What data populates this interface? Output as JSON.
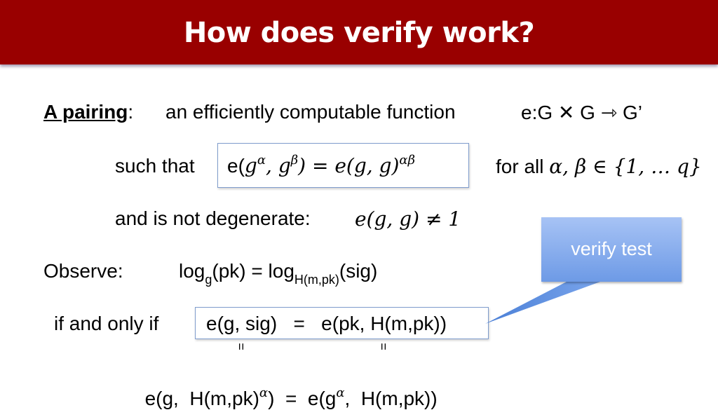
{
  "title": "How does verify work?",
  "pairing": {
    "label": "A pairing",
    "colon": ":",
    "description": "an efficiently computable function",
    "signature": "e:G ✕ G ⇾ G’"
  },
  "bilinear": {
    "prefix": "such that",
    "lhs_e": "e(",
    "lhs_g1": "g",
    "lhs_exp1": "α",
    "comma": ", ",
    "lhs_g2": "g",
    "lhs_exp2": "β",
    "rhs": ") = e(g, g)",
    "rhs_exp": "αβ",
    "forall": "for all",
    "domain": "α, β ∈ {1, … q}"
  },
  "nondegenerate": {
    "prefix": "and is not degenerate:",
    "expr": "e(g, g) ≠ 1"
  },
  "observe": {
    "label": "Observe:",
    "log1": "log",
    "log1_sub": "g",
    "mid": "(pk) = log",
    "log2_sub": "H(m,pk)",
    "end": "(sig)"
  },
  "iff": {
    "prefix": "if and only if",
    "equation": "e(g, sig)   =   e(pk, H(m,pk))"
  },
  "equals_marks": [
    "=",
    "="
  ],
  "derived": {
    "left": "e(g,  H(m,pk)",
    "left_exp": "α",
    "left_close": ")",
    "middle": "  =  ",
    "right": "e(g",
    "right_exp": "α",
    "right_rest": ",  H(m,pk))"
  },
  "callout": {
    "label": "verify test",
    "color_top": "#a7c3f5",
    "color_bottom": "#6d9ae6"
  },
  "colors": {
    "title_bar": "#990000",
    "box_border": "#7f9ccc"
  }
}
